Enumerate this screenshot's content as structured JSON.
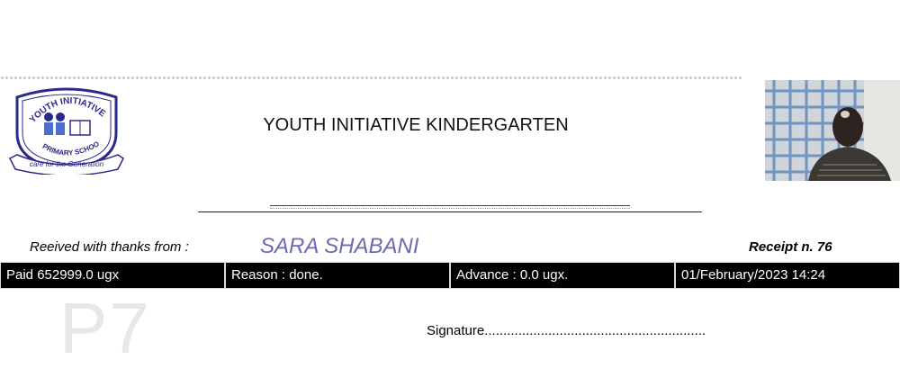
{
  "logo": {
    "top_text": "YOUTH INITIATIVE",
    "middle_text": "PRIMARY SCHOOL",
    "ribbon_text": "care for the Generation"
  },
  "header": {
    "school_name": "YOUTH INITIATIVE KINDERGARTEN"
  },
  "receipt": {
    "received_label": "Reeived with thanks from :",
    "payer_name": "SARA SHABANI",
    "receipt_number": "Receipt n. 76",
    "paid": "Paid 652999.0 ugx",
    "reason": "Reason : done.",
    "advance": "Advance : 0.0 ugx.",
    "datetime": "01/February/2023 14:24",
    "class_mark": "P7",
    "signature": "Signature..........................................................."
  },
  "colors": {
    "name_accent": "#6b6bb3",
    "bar_bg": "#000000",
    "logo_blue": "#2a2a8a"
  },
  "icons": {
    "photo": "student-photo"
  }
}
